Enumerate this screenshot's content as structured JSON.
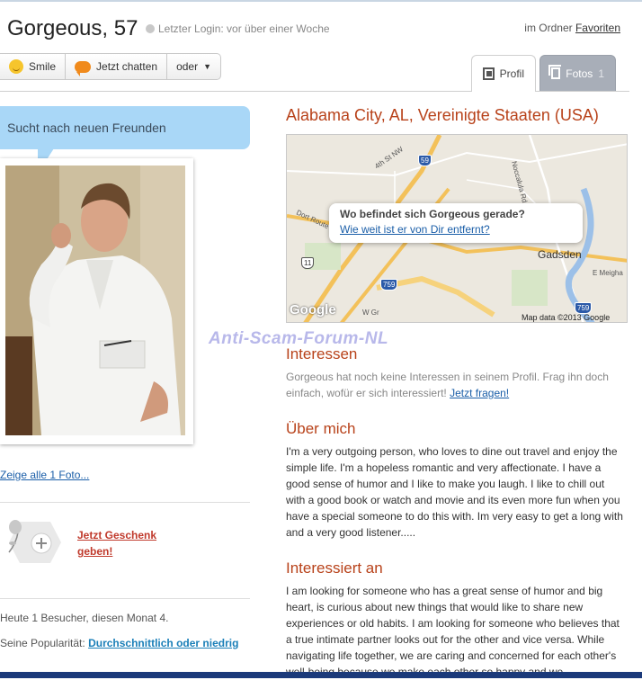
{
  "header": {
    "name_age": "Gorgeous, 57",
    "last_login": "Letzter Login: vor über einer Woche",
    "folder_prefix": "im Ordner",
    "folder_link": "Favoriten"
  },
  "actions": {
    "smile": "Smile",
    "chat": "Jetzt chatten",
    "more": "oder"
  },
  "tabs": {
    "profil": "Profil",
    "fotos": "Fotos",
    "fotos_count": "1"
  },
  "left": {
    "status": "Sucht nach neuen Freunden",
    "see_all_photos": "Zeige alle 1 Foto...",
    "gift_line1": "Jetzt Geschenk",
    "gift_line2": "geben!",
    "visitors": "Heute 1 Besucher, diesen Monat 4.",
    "popularity_label": "Seine Popularität:",
    "popularity_value": "Durchschnittlich oder niedrig"
  },
  "location": "Alabama City, AL, Vereinigte Staaten (USA)",
  "map": {
    "popup_question": "Wo befindet sich Gorgeous gerade?",
    "popup_link": "Wie weit ist er von Dir entfernt?",
    "city_label": "Gadsden",
    "credit": "Map data ©2013 Google",
    "logo": "Google",
    "street_labels": [
      "4th St NW",
      "Noccalula Rd",
      "E Meigha",
      "W Gr",
      "Dort Route"
    ],
    "route_shields": [
      "59",
      "11",
      "759",
      "759"
    ]
  },
  "watermark": "Anti-Scam-Forum-NL",
  "sections": {
    "interests_title": "Interessen",
    "interests_text": "Gorgeous hat noch keine Interessen in seinem Profil. Frag ihn doch einfach, wofür er sich interessiert!",
    "interests_link": "Jetzt fragen!",
    "about_title": "Über mich",
    "about_text": "I'm a very outgoing person, who loves to dine out travel and enjoy the simple life. I'm a hopeless romantic and very affectionate. I have a good sense of humor and I like to make you laugh. I like to chill out with a good book or watch and movie and its even more fun when you have a special someone to do this with. Im very easy to get a long with and a very good listener.....",
    "interested_title": "Interessiert an",
    "interested_text": "I am looking for someone who has a great sense of humor and big heart, is curious about new things that would like to share new experiences or old habits. I am looking for someone who believes that a true intimate partner looks out for the other and vice versa. While navigating life together, we are caring and concerned for each other's well-being because we make each other so happy and we"
  },
  "colors": {
    "accent_title": "#b8421a",
    "link": "#1a5ea8",
    "bubble": "#a9d7f7",
    "gift_link": "#c0392b"
  }
}
